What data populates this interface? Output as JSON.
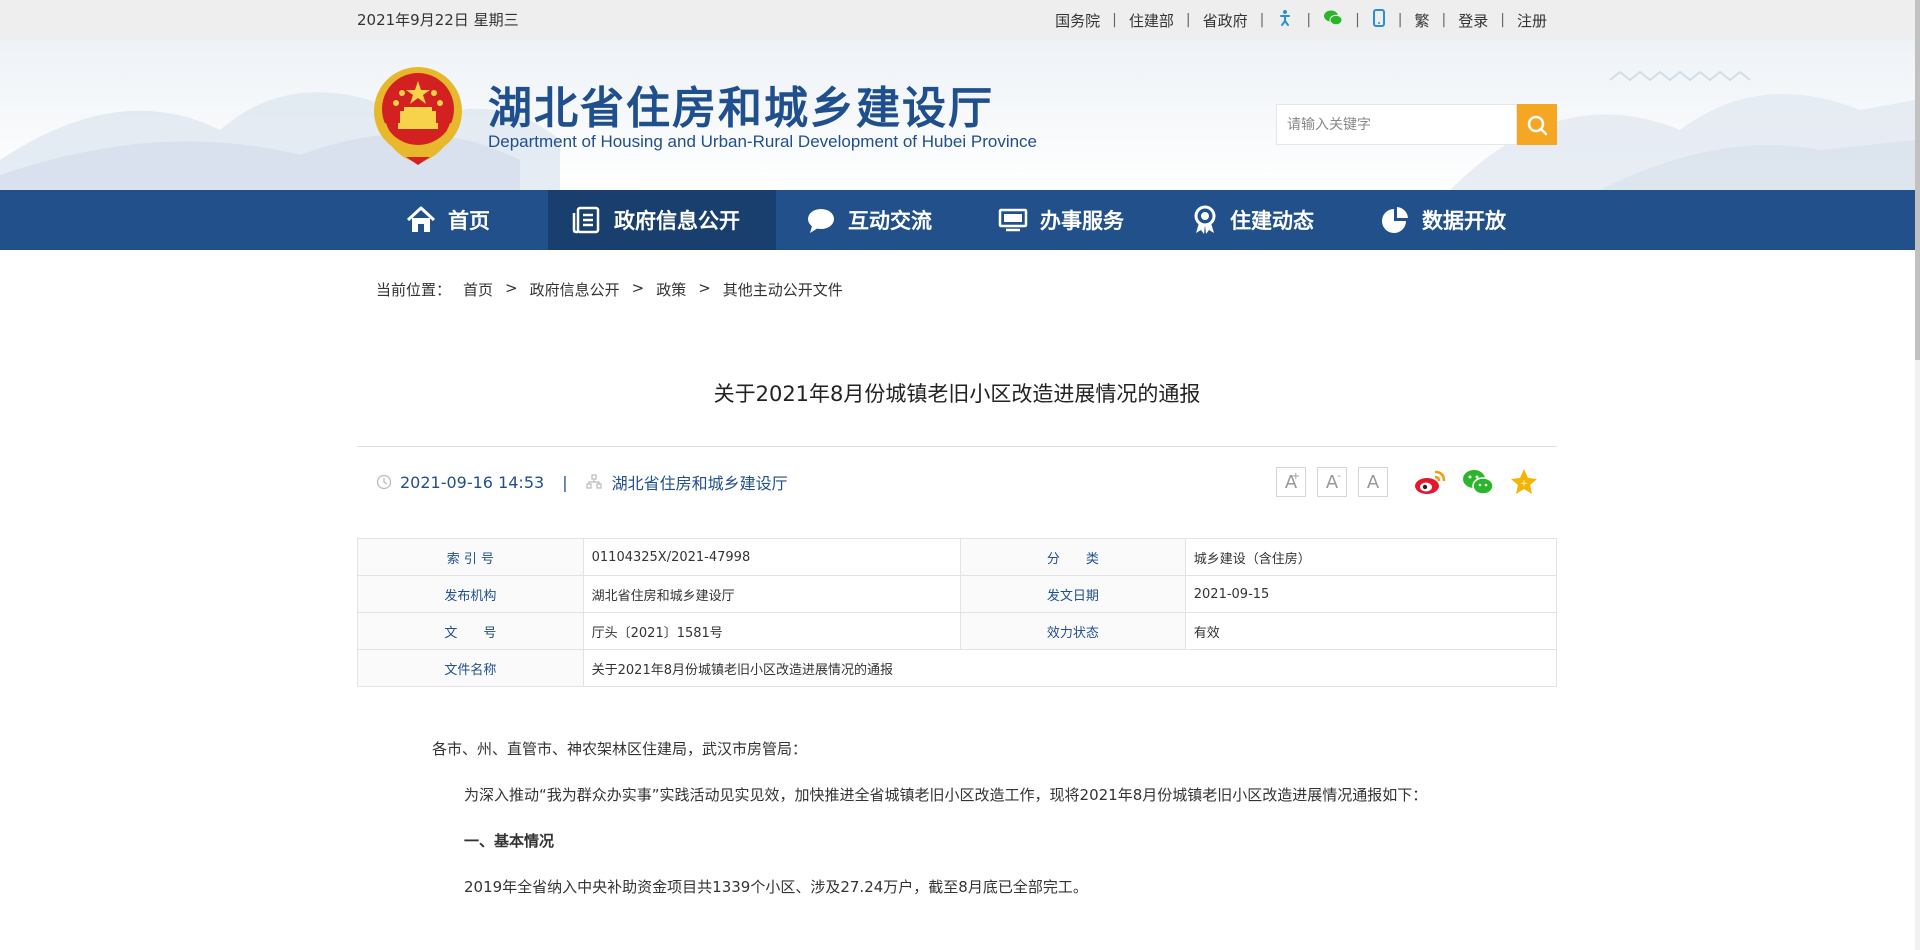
{
  "topbar": {
    "date": "2021年9月22日 星期三",
    "links": [
      "国务院",
      "住建部",
      "省政府",
      "繁",
      "登录",
      "注册"
    ],
    "icons": [
      "accessibility-icon",
      "wechat-icon",
      "mobile-icon"
    ]
  },
  "header": {
    "title": "湖北省住房和城乡建设厅",
    "subtitle": "Department of Housing and Urban-Rural Development of Hubei Province",
    "search_placeholder": "请输入关键字"
  },
  "nav": {
    "items": [
      {
        "label": "首页",
        "icon": "home-icon"
      },
      {
        "label": "政府信息公开",
        "icon": "document-icon",
        "active": true
      },
      {
        "label": "互动交流",
        "icon": "chat-icon"
      },
      {
        "label": "办事服务",
        "icon": "monitor-icon"
      },
      {
        "label": "住建动态",
        "icon": "award-icon"
      },
      {
        "label": "数据开放",
        "icon": "pie-chart-icon"
      }
    ]
  },
  "breadcrumb": {
    "prefix": "当前位置：",
    "items": [
      "首页",
      "政府信息公开",
      "政策",
      "其他主动公开文件"
    ],
    "separator": ">"
  },
  "article": {
    "title": "关于2021年8月份城镇老旧小区改造进展情况的通报",
    "datetime": "2021-09-16 14:53",
    "publisher": "湖北省住房和城乡建设厅",
    "font_buttons": [
      "A",
      "A",
      "A"
    ],
    "share_icons": [
      "weibo-icon",
      "wechat-share-icon",
      "favorite-star-icon"
    ]
  },
  "info": {
    "rows": [
      {
        "k1": "索 引 号",
        "v1": "01104325X/2021-47998",
        "k2": "分　　类",
        "v2": "城乡建设（含住房）"
      },
      {
        "k1": "发布机构",
        "v1": "湖北省住房和城乡建设厅",
        "k2": "发文日期",
        "v2": "2021-09-15"
      },
      {
        "k1": "文　　号",
        "v1": "厅头〔2021〕1581号",
        "k2": "效力状态",
        "v2": "有效"
      },
      {
        "k1": "文件名称",
        "v1": "关于2021年8月份城镇老旧小区改造进展情况的通报"
      }
    ]
  },
  "content": {
    "salutation": "各市、州、直管市、神农架林区住建局，武汉市房管局：",
    "p1": "为深入推动“我为群众办实事”实践活动见实见效，加快推进全省城镇老旧小区改造工作，现将2021年8月份城镇老旧小区改造进展情况通报如下：",
    "h1": "一、基本情况",
    "p2": "2019年全省纳入中央补助资金项目共1339个小区、涉及27.24万户，截至8月底已全部完工。"
  },
  "colors": {
    "primary": "#22508a",
    "nav_active": "#193f6f",
    "search_button": "#f5a623",
    "topbar_bg": "#eeeeee"
  }
}
